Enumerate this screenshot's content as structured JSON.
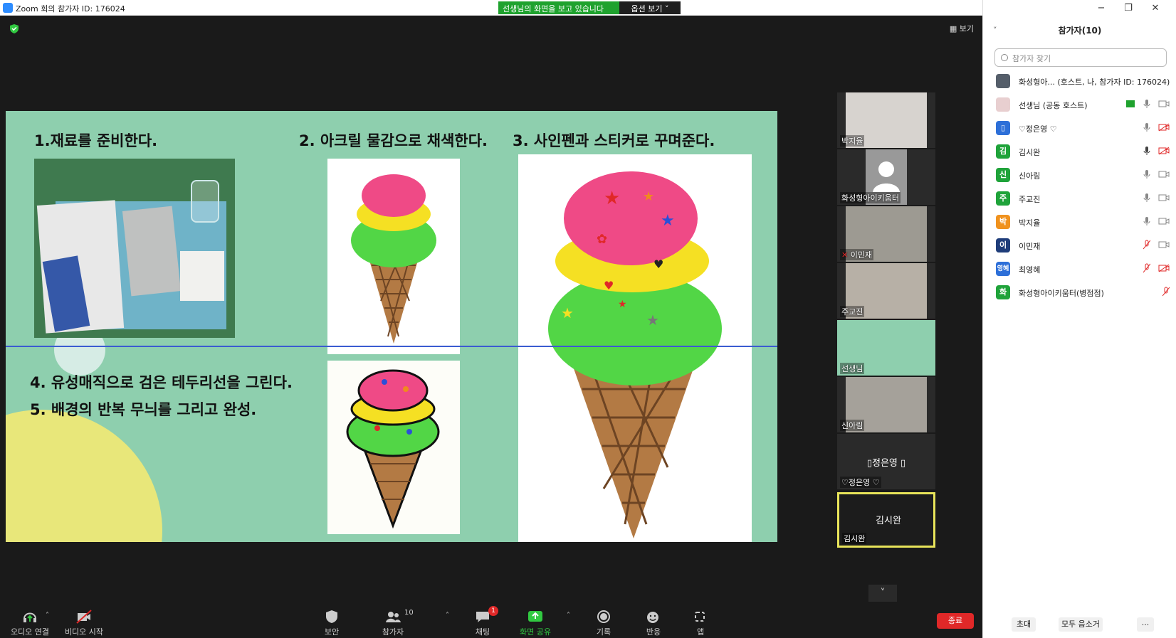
{
  "window": {
    "title": "Zoom 회의 참가자 ID: 176024",
    "share_banner": "선생님의 화면을 보고 있습니다",
    "options_label": "옵션 보기",
    "view_label": "보기"
  },
  "slide": {
    "step1": "1.재료를 준비한다.",
    "step2": "2. 아크릴 물감으로 채색한다.",
    "step3": "3. 사인펜과 스티커로 꾸며준다.",
    "step4": "4. 유성매직으로 검은 테두리선을 그린다.",
    "step5": "5. 배경의 반복 무늬를 그리고 완성."
  },
  "gallery": [
    {
      "name": "박지율"
    },
    {
      "name": "화성형아이키움터"
    },
    {
      "name": "이민재"
    },
    {
      "name": "주교진"
    },
    {
      "name": "선생님"
    },
    {
      "name": "신아림"
    },
    {
      "name": "♡정은영 ♡",
      "display": "▯정은영 ▯"
    },
    {
      "name": "김시완",
      "display": "김시완"
    }
  ],
  "toolbar": {
    "audio": "오디오 연결",
    "video": "비디오 시작",
    "security": "보안",
    "participants": "참가자",
    "participants_count": "10",
    "chat": "채팅",
    "chat_badge": "1",
    "share": "화면 공유",
    "record": "기록",
    "reactions": "반응",
    "apps": "앱",
    "end": "종료"
  },
  "panel": {
    "title": "참가자(10)",
    "search_placeholder": "참가자 찾기",
    "participants": [
      {
        "name": "화성형아... (호스트, 나, 참가자 ID: 176024)",
        "avatar": "",
        "color": "#555e6a"
      },
      {
        "name": "선생님 (공동 호스트)",
        "avatar": "",
        "color": "#e8cfd0"
      },
      {
        "name": "♡정은영 ♡",
        "avatar": "▯",
        "color": "#2d6fd8"
      },
      {
        "name": "김시완",
        "avatar": "김",
        "color": "#1fa33a"
      },
      {
        "name": "신아림",
        "avatar": "신",
        "color": "#1fa33a"
      },
      {
        "name": "주교진",
        "avatar": "주",
        "color": "#1fa33a"
      },
      {
        "name": "박지율",
        "avatar": "박",
        "color": "#f0921e"
      },
      {
        "name": "이민재",
        "avatar": "이",
        "color": "#1f3d7a"
      },
      {
        "name": "최영혜",
        "avatar": "영혜",
        "color": "#2d6fd8"
      },
      {
        "name": "화성형아이키움터(병점점)",
        "avatar": "화",
        "color": "#1fa33a"
      }
    ],
    "invite": "초대",
    "mute_all": "모두 음소거",
    "more": "..."
  }
}
